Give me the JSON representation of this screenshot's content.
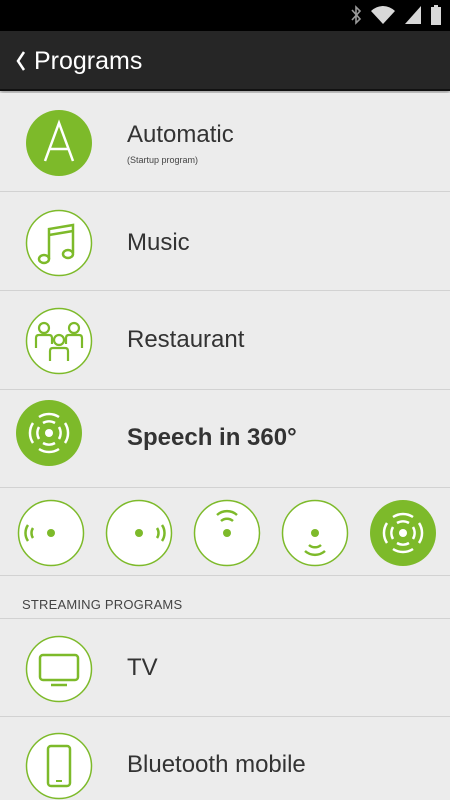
{
  "colors": {
    "accent": "#7dba2a",
    "statusbar": "#000000",
    "actionbar": "#262626",
    "background": "#ececec"
  },
  "statusbar": {
    "icons": [
      "bluetooth-icon",
      "wifi-icon",
      "signal-icon",
      "battery-icon"
    ]
  },
  "header": {
    "title": "Programs",
    "back_icon": "chevron-left-icon"
  },
  "programs": [
    {
      "label": "Automatic",
      "sublabel": "(Startup program)",
      "icon": "letter-a-icon",
      "selected": false
    },
    {
      "label": "Music",
      "icon": "music-note-icon",
      "selected": false
    },
    {
      "label": "Restaurant",
      "icon": "people-group-icon",
      "selected": false
    },
    {
      "label": "Speech in 360°",
      "icon": "speech-360-icon",
      "selected": true
    }
  ],
  "direction_selector": {
    "options": [
      "speech-left-icon",
      "speech-right-icon",
      "speech-front-icon",
      "speech-back-icon",
      "speech-360-icon"
    ],
    "selected_index": 4
  },
  "streaming": {
    "section_title": "STREAMING PROGRAMS",
    "items": [
      {
        "label": "TV",
        "icon": "tv-icon"
      },
      {
        "label": "Bluetooth mobile",
        "icon": "phone-icon"
      }
    ]
  }
}
